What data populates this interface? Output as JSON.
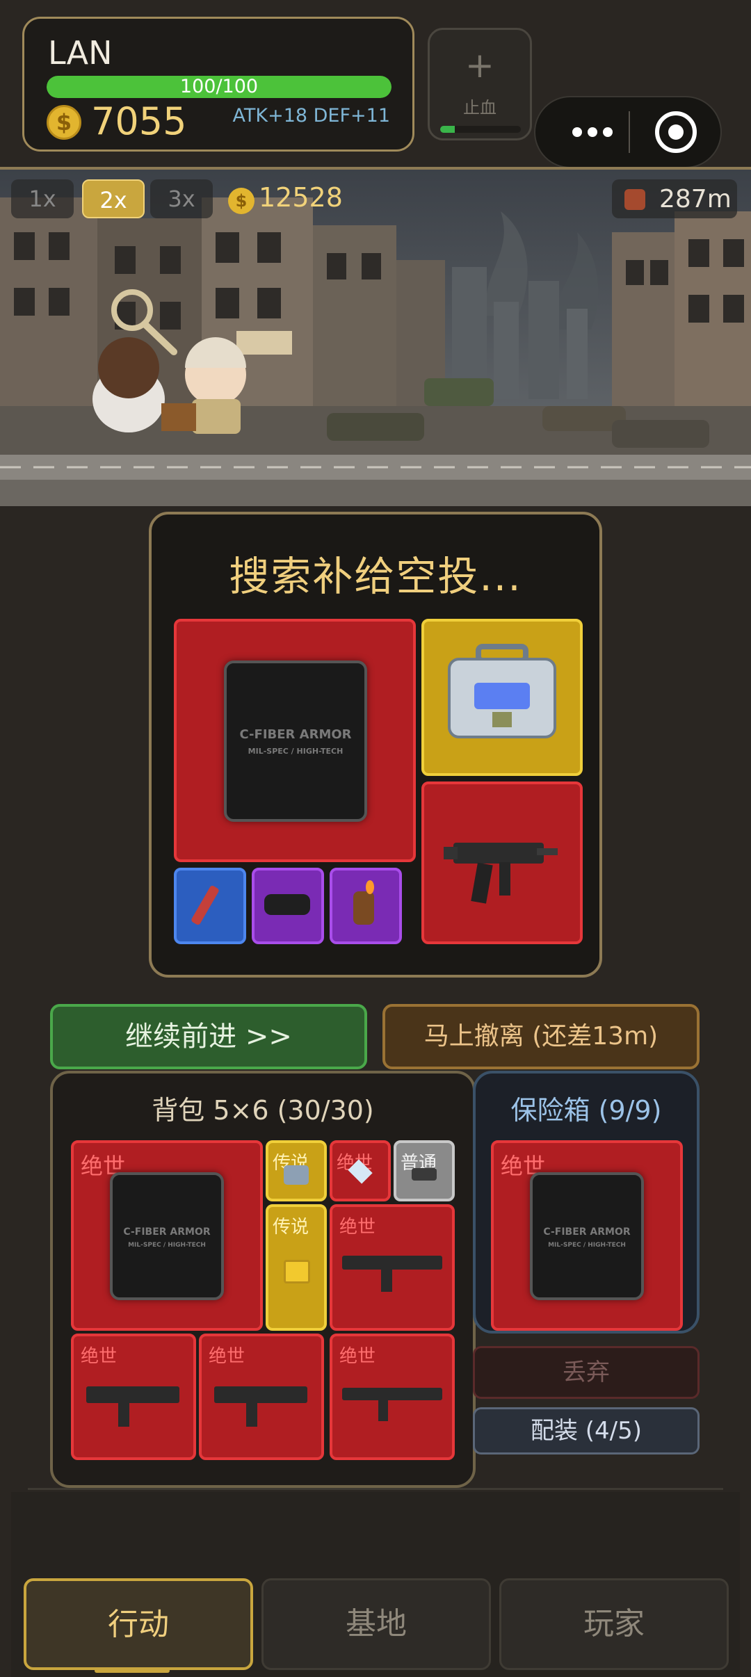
{
  "player": {
    "name": "LAN",
    "hp_text": "100/100",
    "hp_fraction": 1.0,
    "gold": "7055",
    "stats": "ATK+18 DEF+11"
  },
  "heal": {
    "label": "止血",
    "plus": "+",
    "progress_fraction": 0.18
  },
  "scene": {
    "speeds": [
      "1x",
      "2x",
      "3x"
    ],
    "active_speed": "2x",
    "coins": "12528",
    "distance": "287m"
  },
  "loot": {
    "title": "搜索补给空投...",
    "armor_text_1": "C-FIBER ARMOR",
    "armor_text_2": "MIL-SPEC / HIGH-TECH"
  },
  "actions": {
    "continue_label": "继续前进 >>",
    "evacuate_label": "马上撤离 (还差13m)"
  },
  "backpack": {
    "title": "背包 5×6 (30/30)",
    "rarity_mythic": "绝世",
    "rarity_legend": "传说",
    "rarity_common": "普通"
  },
  "safe_box": {
    "title": "保险箱 (9/9)",
    "rarity": "绝世"
  },
  "item_actions": {
    "discard_label": "丢弃",
    "equip_label": "配装 (4/5)"
  },
  "tabs": {
    "action": "行动",
    "base": "基地",
    "player": "玩家"
  },
  "coin_symbol": "$",
  "colors": {
    "mythic": "#b01e22",
    "legend": "#c9a117",
    "rare_blue": "#2c5ebf",
    "epic": "#7a2bb4",
    "common": "#8a8a8a",
    "hp": "#4cc23a",
    "accent_gold": "#c9a63e"
  }
}
